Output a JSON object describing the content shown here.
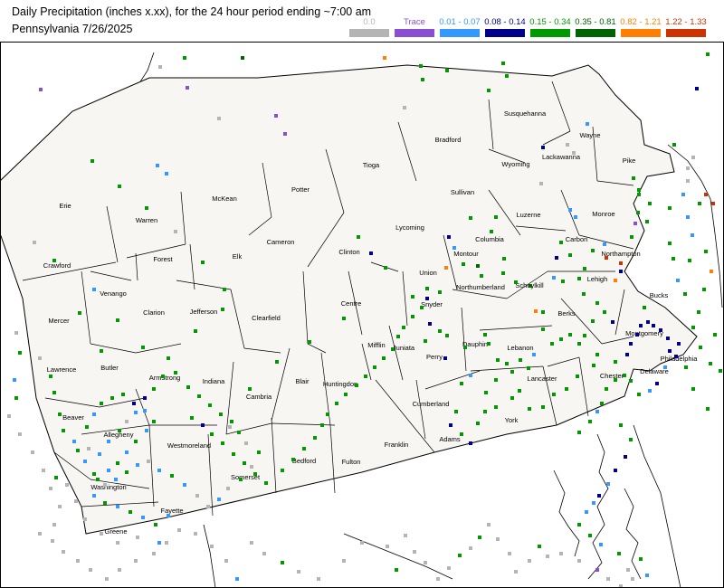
{
  "header": {
    "title": "Daily Precipitation (inches  x.xx),  for the 24 hour period ending ~7:00 am",
    "subtitle": "Pennsylvania 7/26/2025"
  },
  "legend": [
    {
      "label": "0.0",
      "color": "#b4b4b4"
    },
    {
      "label": "Trace",
      "color": "#8a4fd0"
    },
    {
      "label": "0.01 - 0.07",
      "color": "#3399ff"
    },
    {
      "label": "0.08 - 0.14",
      "color": "#00008b"
    },
    {
      "label": "0.15 - 0.34",
      "color": "#009900"
    },
    {
      "label": "0.35 - 0.81",
      "color": "#006400"
    },
    {
      "label": "0.82 - 1.21",
      "color": "#ff7f00"
    },
    {
      "label": "1.22 - 1.33",
      "color": "#cc3300"
    }
  ],
  "counties": [
    "Erie",
    "Warren",
    "McKean",
    "Potter",
    "Tioga",
    "Bradford",
    "Susquehanna",
    "Wayne",
    "Crawford",
    "Forest",
    "Elk",
    "Cameron",
    "Clinton",
    "Lycoming",
    "Sullivan",
    "Wyoming",
    "Lackawanna",
    "Pike",
    "Venango",
    "Mercer",
    "Clarion",
    "Jefferson",
    "Clearfield",
    "Centre",
    "Union",
    "Montour",
    "Columbia",
    "Luzerne",
    "Monroe",
    "Carbon",
    "Northampton",
    "Lehigh",
    "Lawrence",
    "Butler",
    "Armstrong",
    "Indiana",
    "Cambria",
    "Blair",
    "Huntingdon",
    "Mifflin",
    "Juniata",
    "Snyder",
    "Northumberland",
    "Schuylkill",
    "Berks",
    "Bucks",
    "Montgomery",
    "Philadelphia",
    "Beaver",
    "Allegheny",
    "Westmoreland",
    "Perry",
    "Dauphin",
    "Lebanon",
    "Lancaster",
    "Chester",
    "Delaware",
    "Cumberland",
    "York",
    "Adams",
    "Franklin",
    "Fulton",
    "Bedford",
    "Somerset",
    "Washington",
    "Fayette",
    "Greene"
  ]
}
